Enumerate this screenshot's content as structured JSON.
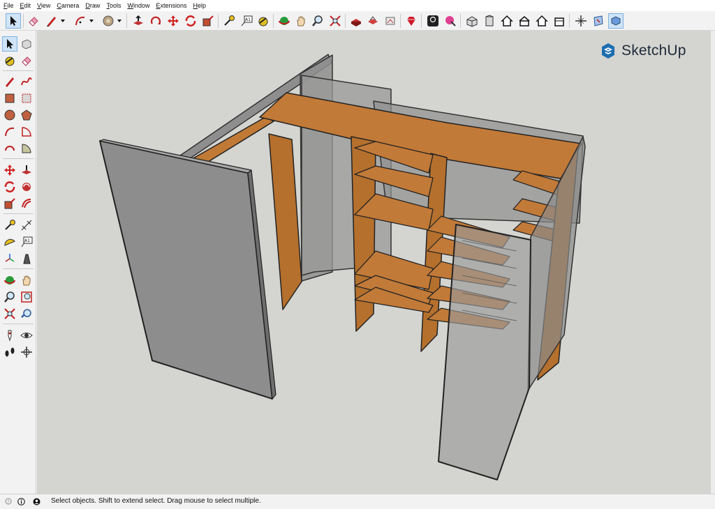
{
  "menu": [
    "File",
    "Edit",
    "View",
    "Camera",
    "Draw",
    "Tools",
    "Window",
    "Extensions",
    "Help"
  ],
  "brand": {
    "name": "SketchUp",
    "color": "#1e6fb0"
  },
  "toolbar": {
    "ocl_label": "OCL",
    "icons": [
      "select-icon",
      "eraser-icon",
      "pencil-icon",
      "arc-icon",
      "paint-bucket-icon",
      "push-pull-icon",
      "rotate-icon",
      "move-icon",
      "scale-icon",
      "tape-measure-icon",
      "text-icon",
      "paint-icon",
      "orbit-icon",
      "pan-icon",
      "zoom-icon",
      "zoom-extents-icon",
      "component-icon",
      "warehouse-icon",
      "extension-icon",
      "ruby-icon",
      "ocl-icon",
      "brush-icon",
      "iso-view-icon",
      "front-view-icon",
      "home-icon",
      "top-view-icon",
      "back-view-icon",
      "right-view-icon",
      "axes-icon",
      "section-plane-icon",
      "display-section-icon"
    ]
  },
  "left_tools": {
    "text_tool_label": "A1",
    "icons": [
      "select-icon",
      "component-icon",
      "paint-bucket-icon",
      "eraser-icon",
      "line-icon",
      "freehand-icon",
      "rectangle-icon",
      "rotated-rectangle-icon",
      "circle-icon",
      "polygon-icon",
      "arc-icon",
      "pie-icon",
      "two-point-arc-icon",
      "three-point-arc-icon",
      "move-icon",
      "push-pull-icon",
      "rotate-icon",
      "follow-me-icon",
      "scale-icon",
      "offset-icon",
      "tape-measure-icon",
      "dimension-icon",
      "protractor-icon",
      "text-icon",
      "axes-icon",
      "3d-text-icon",
      "orbit-icon",
      "pan-icon",
      "zoom-icon",
      "zoom-window-icon",
      "zoom-extents-icon",
      "previous-view-icon",
      "position-camera-icon",
      "look-around-icon",
      "walk-icon",
      "section-plane-icon"
    ]
  },
  "status": {
    "text": "Select objects. Shift to extend select. Drag mouse to select multiple.",
    "icons": [
      "geo-location-icon",
      "info-icon",
      "user-icon"
    ]
  },
  "colors": {
    "accent": "#1e6fb0",
    "wood": "#c07a35",
    "glass": "#8f8f8f",
    "background": "#d4d4d0"
  }
}
